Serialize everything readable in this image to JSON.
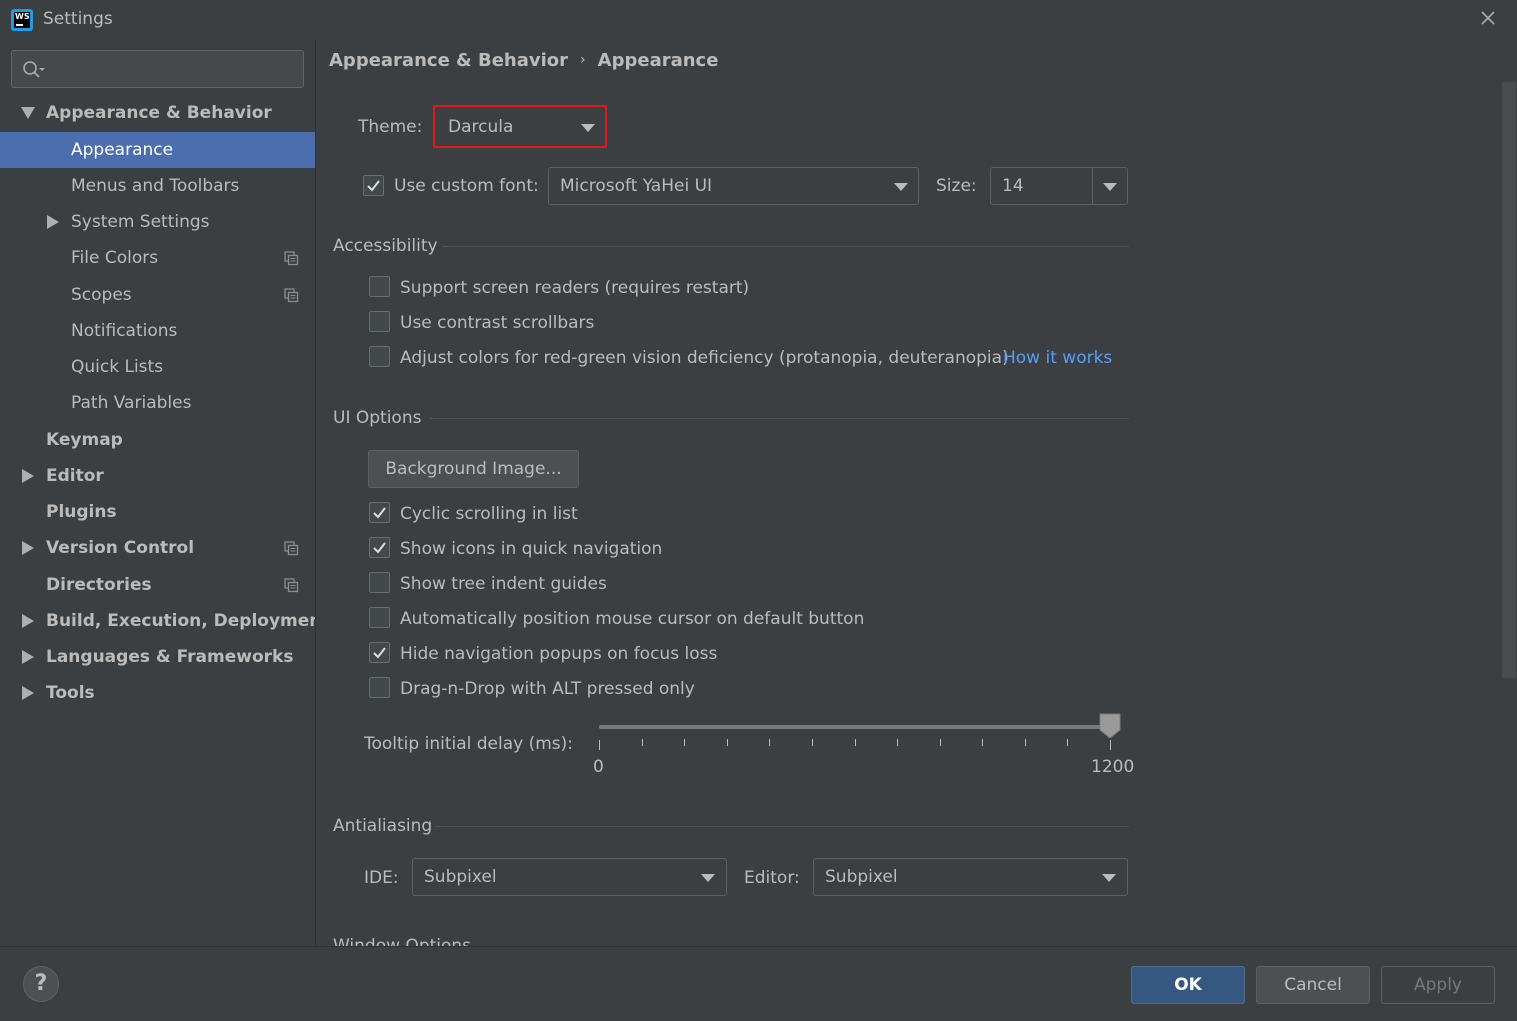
{
  "window": {
    "title": "Settings",
    "app_icon_text": "WS"
  },
  "sidebar": {
    "search": {
      "value": "",
      "placeholder": ""
    },
    "items": [
      {
        "label": "Appearance & Behavior",
        "level": 0,
        "bold": true,
        "expander": "expanded",
        "selected": false,
        "has_copy_icon": false
      },
      {
        "label": "Appearance",
        "level": 1,
        "bold": false,
        "expander": "none",
        "selected": true,
        "has_copy_icon": false
      },
      {
        "label": "Menus and Toolbars",
        "level": 1,
        "bold": false,
        "expander": "none",
        "selected": false,
        "has_copy_icon": false
      },
      {
        "label": "System Settings",
        "level": 1,
        "bold": false,
        "expander": "collapsed",
        "selected": false,
        "has_copy_icon": false
      },
      {
        "label": "File Colors",
        "level": 1,
        "bold": false,
        "expander": "none",
        "selected": false,
        "has_copy_icon": true
      },
      {
        "label": "Scopes",
        "level": 1,
        "bold": false,
        "expander": "none",
        "selected": false,
        "has_copy_icon": true
      },
      {
        "label": "Notifications",
        "level": 1,
        "bold": false,
        "expander": "none",
        "selected": false,
        "has_copy_icon": false
      },
      {
        "label": "Quick Lists",
        "level": 1,
        "bold": false,
        "expander": "none",
        "selected": false,
        "has_copy_icon": false
      },
      {
        "label": "Path Variables",
        "level": 1,
        "bold": false,
        "expander": "none",
        "selected": false,
        "has_copy_icon": false
      },
      {
        "label": "Keymap",
        "level": 0,
        "bold": true,
        "expander": "none",
        "selected": false,
        "has_copy_icon": false
      },
      {
        "label": "Editor",
        "level": 0,
        "bold": true,
        "expander": "collapsed",
        "selected": false,
        "has_copy_icon": false
      },
      {
        "label": "Plugins",
        "level": 0,
        "bold": true,
        "expander": "none",
        "selected": false,
        "has_copy_icon": false
      },
      {
        "label": "Version Control",
        "level": 0,
        "bold": true,
        "expander": "collapsed",
        "selected": false,
        "has_copy_icon": true
      },
      {
        "label": "Directories",
        "level": 0,
        "bold": true,
        "expander": "none",
        "selected": false,
        "has_copy_icon": true
      },
      {
        "label": "Build, Execution, Deployment",
        "level": 0,
        "bold": true,
        "expander": "collapsed",
        "selected": false,
        "has_copy_icon": false
      },
      {
        "label": "Languages & Frameworks",
        "level": 0,
        "bold": true,
        "expander": "collapsed",
        "selected": false,
        "has_copy_icon": false
      },
      {
        "label": "Tools",
        "level": 0,
        "bold": true,
        "expander": "collapsed",
        "selected": false,
        "has_copy_icon": false
      }
    ]
  },
  "breadcrumb": {
    "parent": "Appearance & Behavior",
    "separator": "›",
    "current": "Appearance"
  },
  "theme": {
    "label": "Theme:",
    "value": "Darcula"
  },
  "custom_font": {
    "label": "Use custom font:",
    "checked": true,
    "font_value": "Microsoft YaHei UI",
    "size_label": "Size:",
    "size_value": "14"
  },
  "accessibility": {
    "title": "Accessibility",
    "options": [
      {
        "label": "Support screen readers (requires restart)",
        "checked": false
      },
      {
        "label": "Use contrast scrollbars",
        "checked": false
      },
      {
        "label": "Adjust colors for red-green vision deficiency (protanopia, deuteranopia)",
        "checked": false
      }
    ],
    "link": "How it works"
  },
  "ui_options": {
    "title": "UI Options",
    "background_button": "Background Image...",
    "options": [
      {
        "label": "Cyclic scrolling in list",
        "checked": true
      },
      {
        "label": "Show icons in quick navigation",
        "checked": true
      },
      {
        "label": "Show tree indent guides",
        "checked": false
      },
      {
        "label": "Automatically position mouse cursor on default button",
        "checked": false
      },
      {
        "label": "Hide navigation popups on focus loss",
        "checked": true
      },
      {
        "label": "Drag-n-Drop with ALT pressed only",
        "checked": false
      }
    ],
    "tooltip": {
      "label": "Tooltip initial delay (ms):",
      "min_label": "0",
      "max_label": "1200",
      "min": 0,
      "max": 1200,
      "value": 1200,
      "tick_count": 13
    }
  },
  "antialiasing": {
    "title": "Antialiasing",
    "ide_label": "IDE:",
    "ide_value": "Subpixel",
    "editor_label": "Editor:",
    "editor_value": "Subpixel"
  },
  "window_options": {
    "title": "Window Options"
  },
  "footer": {
    "help": "?",
    "ok": "OK",
    "cancel": "Cancel",
    "apply": "Apply"
  },
  "colors": {
    "background": "#3c3f41",
    "selection": "#4b6eaf",
    "link": "#589df6",
    "highlight_border": "#e01a1a",
    "ok_button": "#365880"
  }
}
